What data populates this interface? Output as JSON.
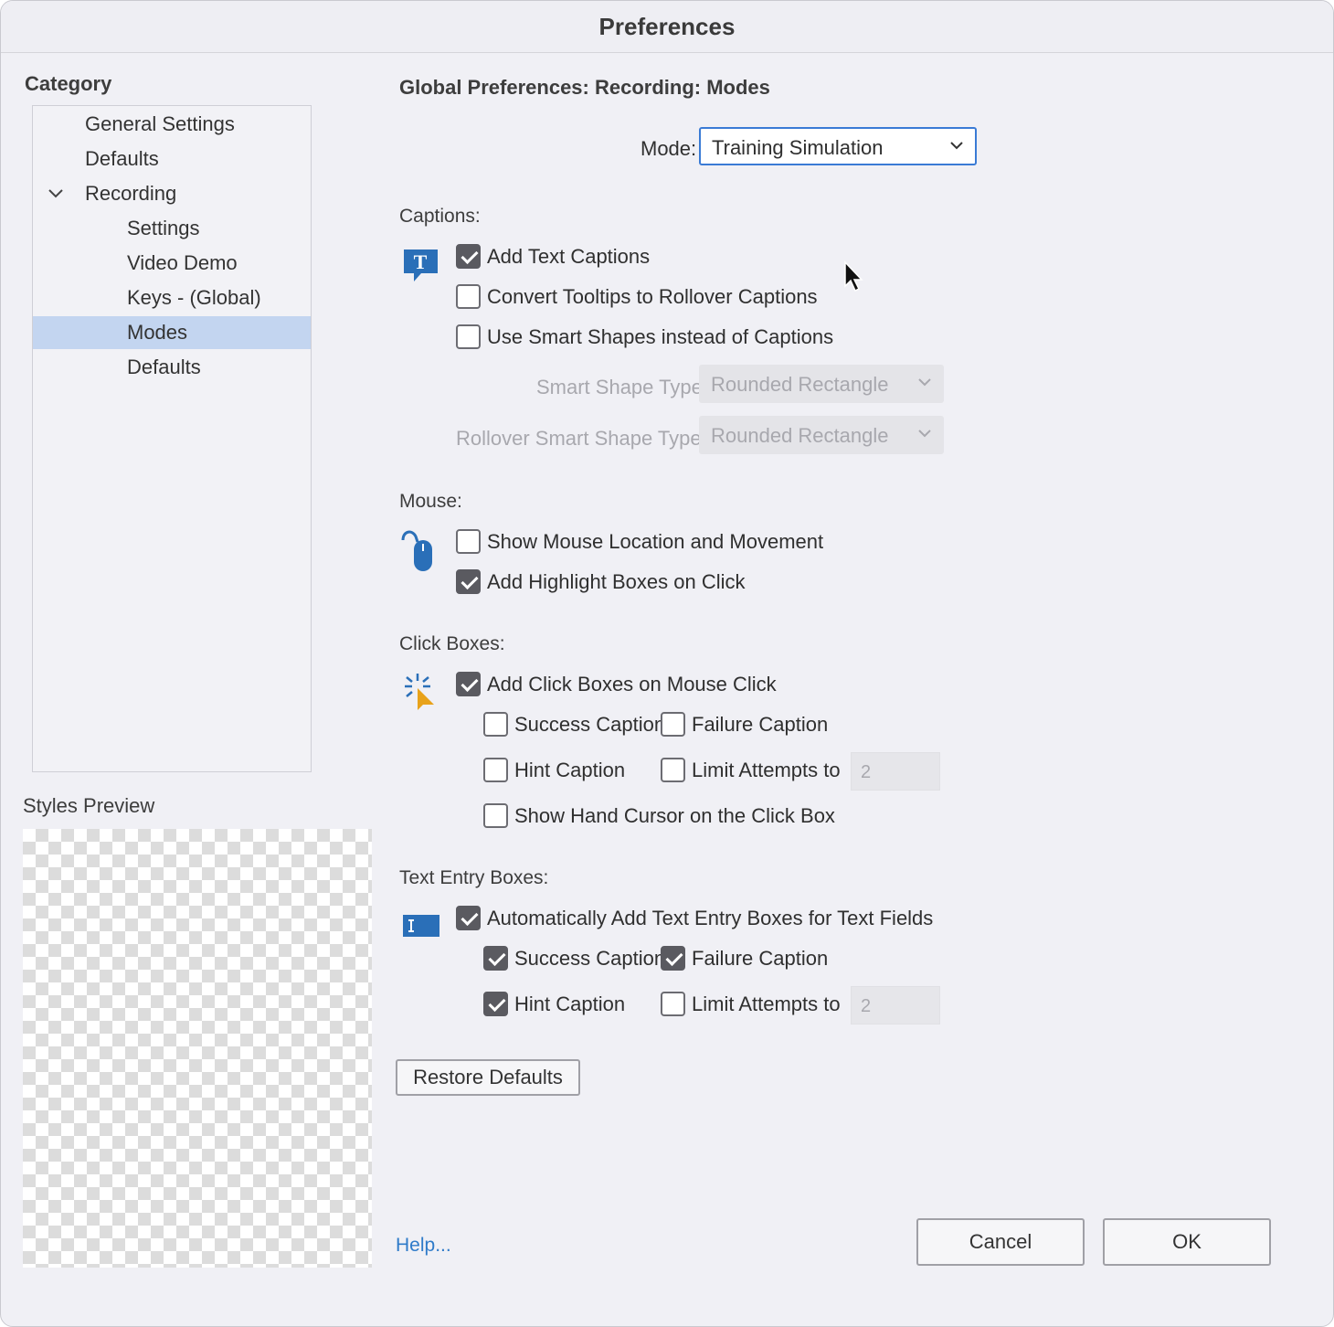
{
  "window": {
    "title": "Preferences"
  },
  "sidebar": {
    "category_label": "Category",
    "items": [
      {
        "label": "General Settings",
        "level": 0
      },
      {
        "label": "Defaults",
        "level": 0
      },
      {
        "label": "Recording",
        "level": 0,
        "expanded": true
      },
      {
        "label": "Settings",
        "level": 1
      },
      {
        "label": "Video Demo",
        "level": 1
      },
      {
        "label": "Keys - (Global)",
        "level": 1
      },
      {
        "label": "Modes",
        "level": 1,
        "selected": true
      },
      {
        "label": "Defaults",
        "level": 1
      }
    ],
    "styles_preview_label": "Styles Preview"
  },
  "main": {
    "heading": "Global Preferences: Recording: Modes",
    "mode_label": "Mode:",
    "mode_value": "Training Simulation",
    "captions": {
      "label": "Captions:",
      "add_text_captions": {
        "label": "Add Text Captions",
        "checked": true
      },
      "convert_tooltips": {
        "label": "Convert Tooltips to Rollover Captions",
        "checked": false
      },
      "use_smart_shapes": {
        "label": "Use Smart Shapes instead of Captions",
        "checked": false
      },
      "smart_shape_type_label": "Smart Shape Type",
      "smart_shape_type_value": "Rounded Rectangle",
      "rollover_shape_type_label": "Rollover Smart Shape Type",
      "rollover_shape_type_value": "Rounded Rectangle"
    },
    "mouse": {
      "label": "Mouse:",
      "show_mouse": {
        "label": "Show Mouse Location and Movement",
        "checked": false
      },
      "highlight_boxes": {
        "label": "Add Highlight Boxes on Click",
        "checked": true
      }
    },
    "click_boxes": {
      "label": "Click Boxes:",
      "add_click_boxes": {
        "label": "Add Click Boxes on Mouse Click",
        "checked": true
      },
      "success_caption": {
        "label": "Success Caption",
        "checked": false
      },
      "failure_caption": {
        "label": "Failure Caption",
        "checked": false
      },
      "hint_caption": {
        "label": "Hint Caption",
        "checked": false
      },
      "limit_attempts": {
        "label": "Limit Attempts to",
        "checked": false,
        "value": "2"
      },
      "hand_cursor": {
        "label": "Show Hand Cursor on the Click Box",
        "checked": false
      }
    },
    "text_entry": {
      "label": "Text Entry Boxes:",
      "auto_add": {
        "label": "Automatically Add Text Entry Boxes for Text Fields",
        "checked": true
      },
      "success_caption": {
        "label": "Success Caption",
        "checked": true
      },
      "failure_caption": {
        "label": "Failure Caption",
        "checked": true
      },
      "hint_caption": {
        "label": "Hint Caption",
        "checked": true
      },
      "limit_attempts": {
        "label": "Limit Attempts to",
        "checked": false,
        "value": "2"
      }
    },
    "restore_defaults": "Restore Defaults"
  },
  "footer": {
    "help": "Help...",
    "cancel": "Cancel",
    "ok": "OK"
  },
  "colors": {
    "accent": "#2f7bc9",
    "selection": "#c3d5f0",
    "icon_blue": "#2a6fb8",
    "icon_orange": "#e8a21a"
  }
}
